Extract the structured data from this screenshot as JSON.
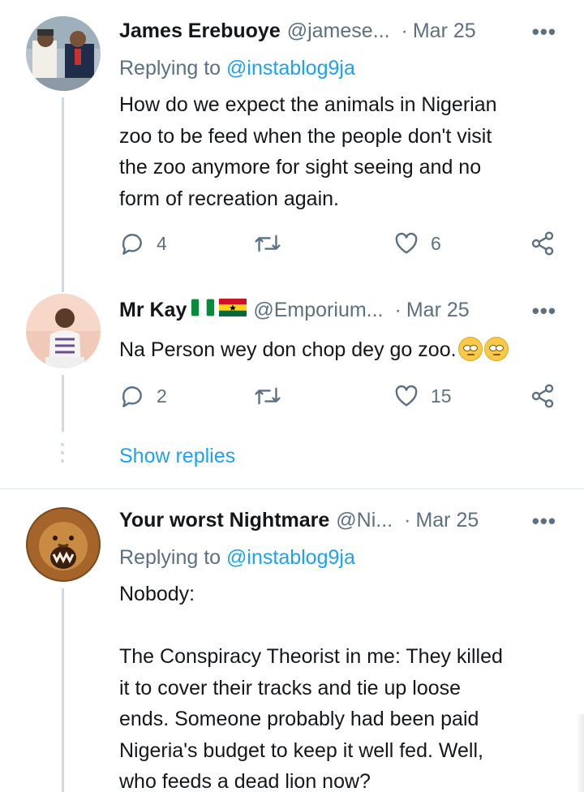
{
  "tweets": [
    {
      "name": "James Erebuoye",
      "handle": "@jamese...",
      "separator": "·",
      "date": "Mar 25",
      "more": "•••",
      "replying_prefix": "Replying to",
      "replying_to": "@instablog9ja",
      "text": "How do we expect the animals in Nigerian\nzoo to be feed when the people don't visit\nthe zoo anymore for sight seeing and no\nform of recreation again.",
      "replies": "4",
      "retweets": "",
      "likes": "6"
    },
    {
      "name": "Mr Kay",
      "name_flags": [
        "nigeria-flag",
        "ghana-flag"
      ],
      "handle": "@Emporium...",
      "separator": "·",
      "date": "Mar 25",
      "more": "•••",
      "text": "Na Person wey don chop dey go zoo.",
      "text_emoji": [
        "face-with-rolling-eyes",
        "face-with-rolling-eyes"
      ],
      "replies": "2",
      "retweets": "",
      "likes": "15"
    },
    {
      "name": "Your worst Nightmare",
      "handle": "@Ni...",
      "separator": "·",
      "date": "Mar 25",
      "more": "•••",
      "replying_prefix": "Replying to",
      "replying_to": "@instablog9ja",
      "text": "Nobody:\n\nThe Conspiracy Theorist in me: They killed\nit to cover their tracks and tie up loose\nends. Someone probably had been paid\nNigeria's budget to keep it well fed. Well,\nwho feeds a dead lion now?"
    }
  ],
  "show_replies": "Show replies",
  "colors": {
    "accent": "#1da1f2",
    "secondary_text": "#5b7083",
    "thread_line": "#cfd9de"
  }
}
